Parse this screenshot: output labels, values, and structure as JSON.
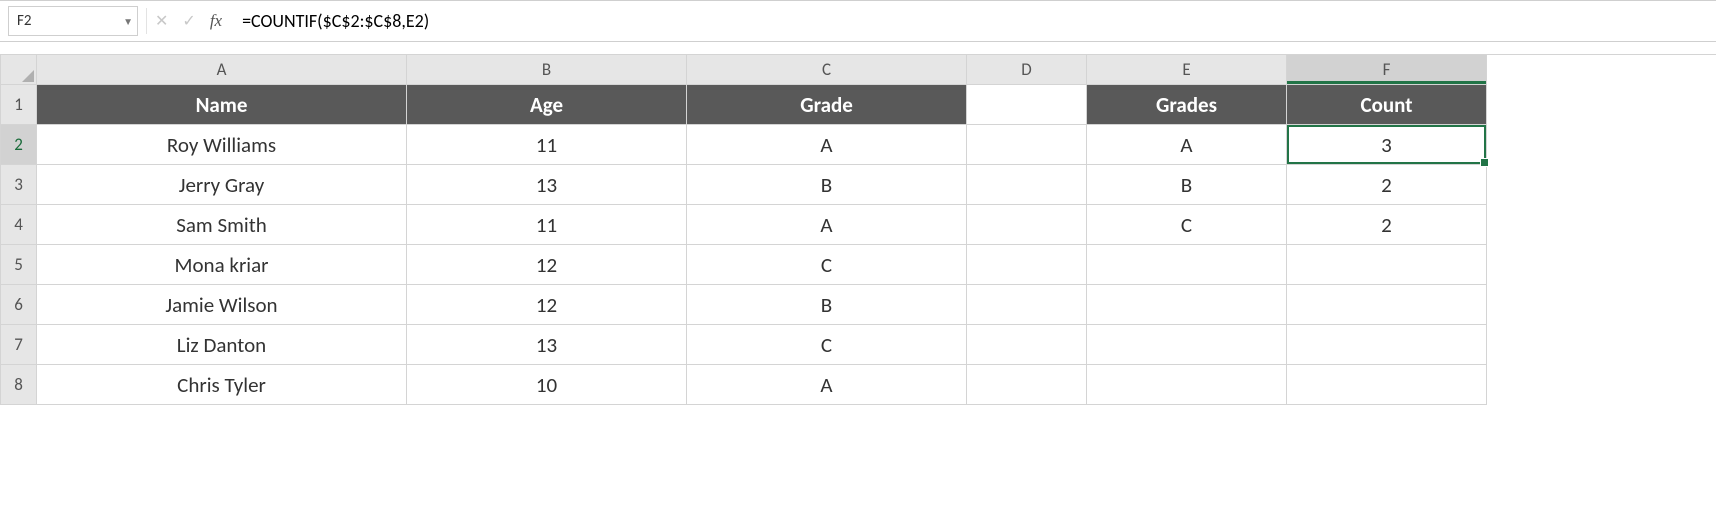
{
  "formula_bar": {
    "cell_ref": "F2",
    "fx_label": "fx",
    "formula": "=COUNTIF($C$2:$C$8,E2)"
  },
  "columns": [
    "A",
    "B",
    "C",
    "D",
    "E",
    "F"
  ],
  "rows": [
    "1",
    "2",
    "3",
    "4",
    "5",
    "6",
    "7",
    "8"
  ],
  "headers": {
    "A": "Name",
    "B": "Age",
    "C": "Grade",
    "D": "",
    "E": "Grades",
    "F": "Count"
  },
  "data": {
    "2": {
      "A": "Roy Williams",
      "B": "11",
      "C": "A",
      "D": "",
      "E": "A",
      "F": "3"
    },
    "3": {
      "A": "Jerry Gray",
      "B": "13",
      "C": "B",
      "D": "",
      "E": "B",
      "F": "2"
    },
    "4": {
      "A": "Sam Smith",
      "B": "11",
      "C": "A",
      "D": "",
      "E": "C",
      "F": "2"
    },
    "5": {
      "A": "Mona kriar",
      "B": "12",
      "C": "C",
      "D": "",
      "E": "",
      "F": ""
    },
    "6": {
      "A": "Jamie Wilson",
      "B": "12",
      "C": "B",
      "D": "",
      "E": "",
      "F": ""
    },
    "7": {
      "A": "Liz Danton",
      "B": "13",
      "C": "C",
      "D": "",
      "E": "",
      "F": ""
    },
    "8": {
      "A": "Chris Tyler",
      "B": "10",
      "C": "A",
      "D": "",
      "E": "",
      "F": ""
    }
  },
  "selection": {
    "cell": "F2",
    "row": "2",
    "col": "F"
  }
}
